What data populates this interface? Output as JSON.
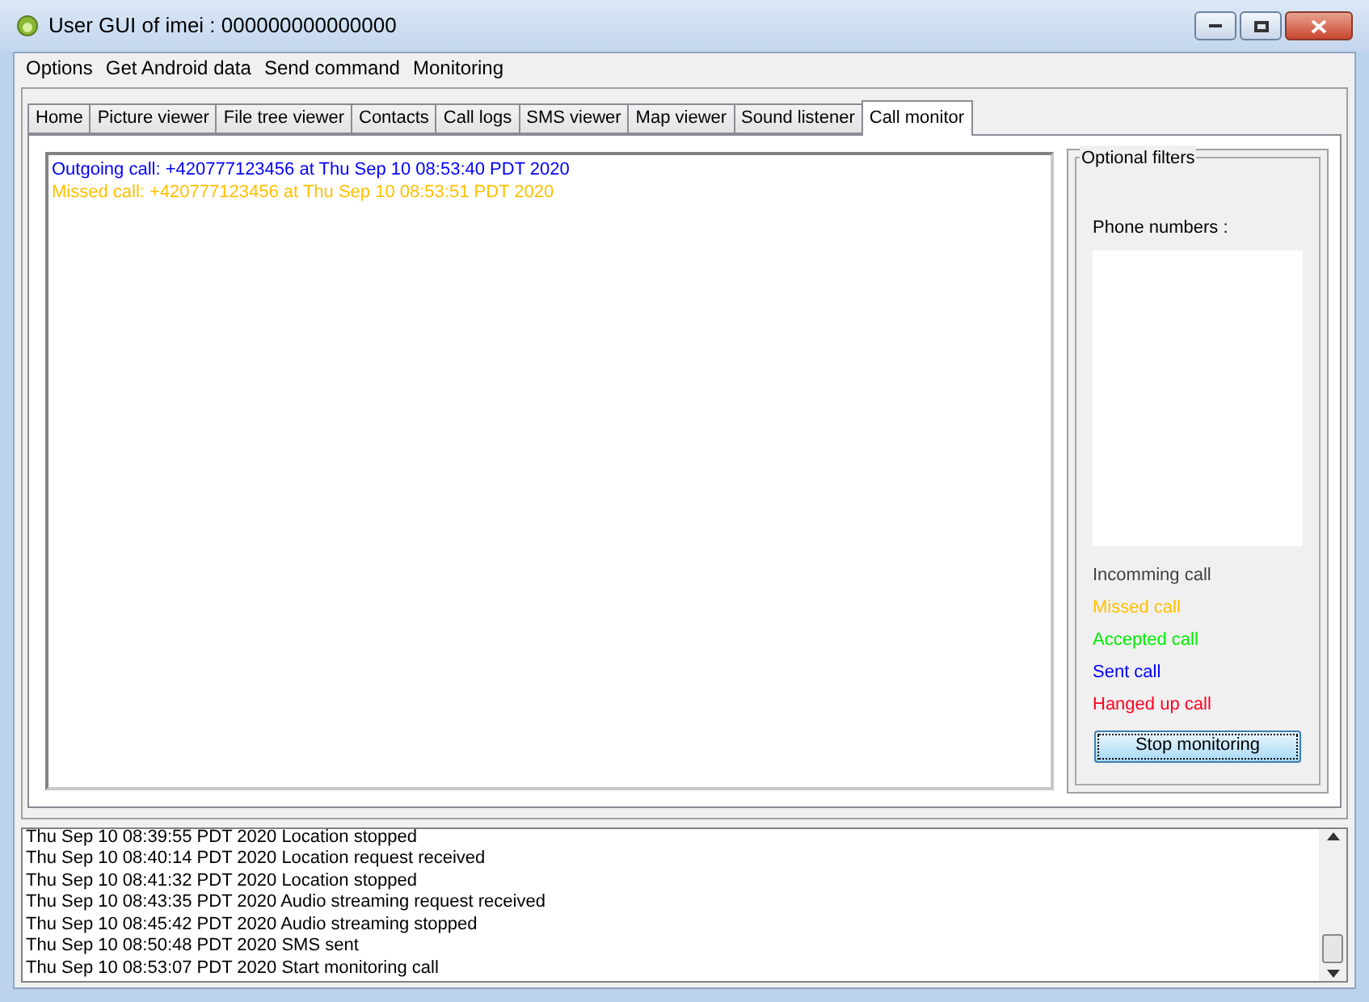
{
  "window": {
    "title": "User GUI of imei : 000000000000000"
  },
  "menu": [
    "Options",
    "Get Android data",
    "Send command",
    "Monitoring"
  ],
  "tabs": [
    {
      "label": "Home",
      "selected": false
    },
    {
      "label": "Picture viewer",
      "selected": false
    },
    {
      "label": "File tree viewer",
      "selected": false
    },
    {
      "label": "Contacts",
      "selected": false
    },
    {
      "label": "Call logs",
      "selected": false
    },
    {
      "label": "SMS viewer",
      "selected": false
    },
    {
      "label": "Map viewer",
      "selected": false
    },
    {
      "label": "Sound listener",
      "selected": false
    },
    {
      "label": "Call monitor",
      "selected": true
    }
  ],
  "call_events": [
    {
      "text": "Outgoing call: +420777123456 at Thu Sep 10 08:53:40 PDT 2020",
      "color": "#0000ff"
    },
    {
      "text": "Missed call: +420777123456 at Thu Sep 10 08:53:51 PDT 2020",
      "color": "#ffc000"
    }
  ],
  "filters": {
    "title": "Optional filters",
    "phone_numbers_label": "Phone numbers :",
    "legend": [
      {
        "label": "Incomming call",
        "color": "#404040"
      },
      {
        "label": "Missed call",
        "color": "#ffc000"
      },
      {
        "label": "Accepted call",
        "color": "#00ee00"
      },
      {
        "label": "Sent call",
        "color": "#0000ff"
      },
      {
        "label": "Hanged up call",
        "color": "#ff0022"
      }
    ],
    "button": "Stop monitoring"
  },
  "log": [
    "Thu Sep 10 08:39:55 PDT 2020 Location stopped",
    "Thu Sep 10 08:40:14 PDT 2020 Location request received",
    "Thu Sep 10 08:41:32 PDT 2020 Location stopped",
    "Thu Sep 10 08:43:35 PDT 2020 Audio streaming request received",
    "Thu Sep 10 08:45:42 PDT 2020 Audio streaming stopped",
    "Thu Sep 10 08:50:48 PDT 2020 SMS sent",
    "Thu Sep 10 08:53:07 PDT 2020 Start monitoring call"
  ]
}
